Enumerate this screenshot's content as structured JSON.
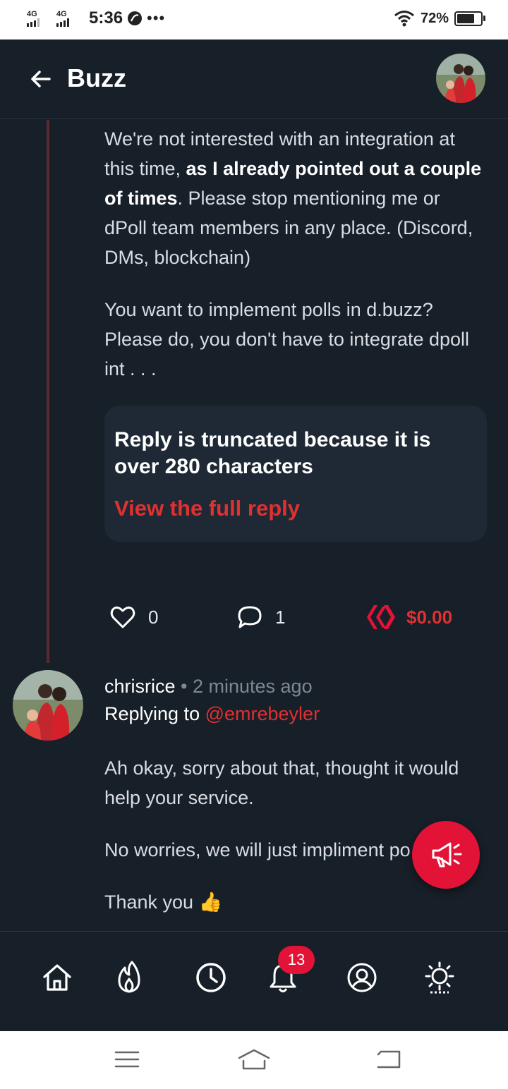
{
  "status_bar": {
    "network1": "4G",
    "network2": "4G",
    "time": "5:36",
    "more": "•••",
    "battery": "72%"
  },
  "header": {
    "title": "Buzz",
    "back_icon": "arrow-left-icon",
    "avatar": "user-avatar"
  },
  "post": {
    "para1_a": "We're not interested with an integration at this time, ",
    "para1_bold": "as I already pointed out a couple of times",
    "para1_b": ". Please stop mentioning me or dPoll team members in any place. (Discord, DMs, blockchain)",
    "para2": "You want to implement polls in d.buzz? Please do, you don't have to integrate dpoll int . . .",
    "truncated_message": "Reply is truncated because it is over 280 characters",
    "view_full_reply": "View the full reply",
    "likes": "0",
    "comments": "1",
    "payout": "$0.00"
  },
  "comment": {
    "author": "chrisrice",
    "time_ago": "• 2 minutes ago",
    "replying_prefix": "Replying to ",
    "replying_to": "@emrebeyler",
    "para1": "Ah okay, sorry about that, thought it would help your service.",
    "para2": "No worries, we will just impliment po",
    "para3": "Thank you",
    "emoji": "👍"
  },
  "fab": {
    "icon": "megaphone-icon"
  },
  "bottom_nav": {
    "items": [
      "home-icon",
      "trending-flame-icon",
      "latest-clock-icon",
      "notifications-bell-icon",
      "profile-icon",
      "theme-sun-icon"
    ],
    "notification_count": "13"
  },
  "colors": {
    "background": "#171f28",
    "accent": "#e31337",
    "link": "#e03131",
    "card": "#1e2935"
  }
}
